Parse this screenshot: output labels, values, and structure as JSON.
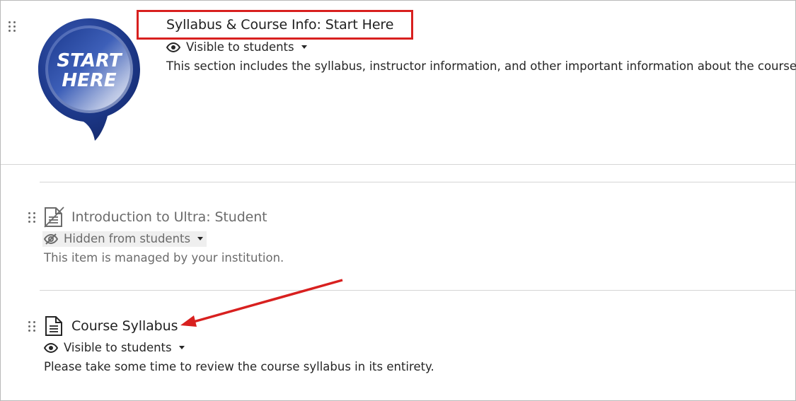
{
  "folder": {
    "title": "Syllabus & Course Info: Start Here",
    "visibility": "Visible to students",
    "description": "This section includes the syllabus, instructor information, and other important information about the course.",
    "image_text_line1": "START",
    "image_text_line2": "HERE",
    "image_icon": "start-here-badge"
  },
  "items": [
    {
      "title": "Introduction to Ultra: Student",
      "visibility": "Hidden from students",
      "description": "This item is managed by your institution.",
      "icon": "document-hidden-icon"
    },
    {
      "title": "Course Syllabus",
      "visibility": "Visible to students",
      "description": "Please take some time to review the course syllabus in its entirety.",
      "icon": "document-icon"
    }
  ],
  "colors": {
    "annotation_red": "#d8201f",
    "badge_blue": "#1f3a8a",
    "text_primary": "#262626",
    "text_muted": "#6b6b6b"
  }
}
